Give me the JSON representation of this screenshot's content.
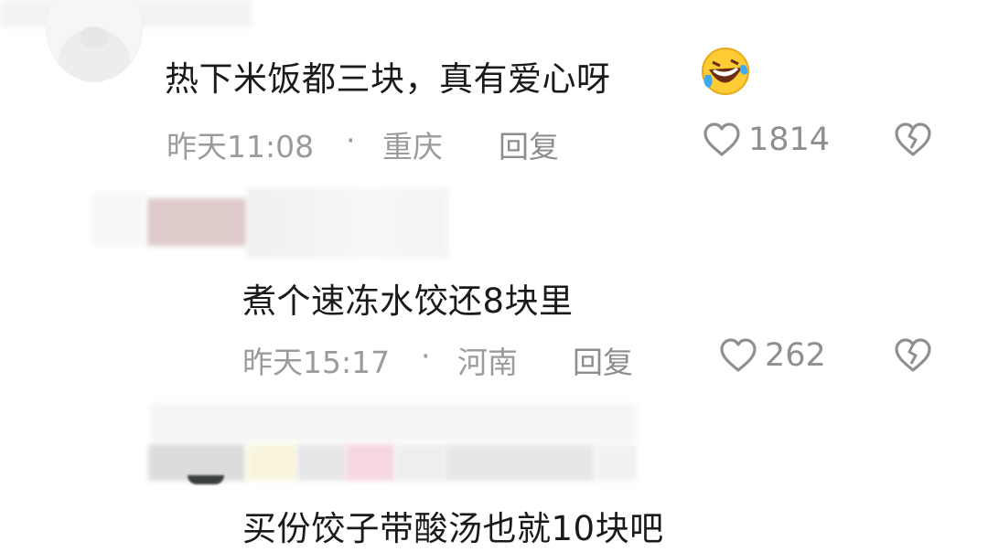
{
  "comments": [
    {
      "text": "热下米饭都三块，真有爱心呀",
      "time": "昨天11:08",
      "separator": "·",
      "location": "重庆",
      "reply_label": "回复",
      "likes": "1814"
    },
    {
      "text": "煮个速冻水饺还8块里",
      "time": "昨天15:17",
      "separator": "·",
      "location": "河南",
      "reply_label": "回复",
      "likes": "262"
    },
    {
      "text": "买份饺子带酸汤也就10块吧"
    }
  ],
  "icons": {
    "like": "heart-outline-icon",
    "dislike": "broken-heart-icon",
    "emoji": "rolling-on-floor-laughing-emoji"
  },
  "colors": {
    "text": "#1a1a1a",
    "meta": "#9b9b9b",
    "icon": "#8f8f8f"
  }
}
